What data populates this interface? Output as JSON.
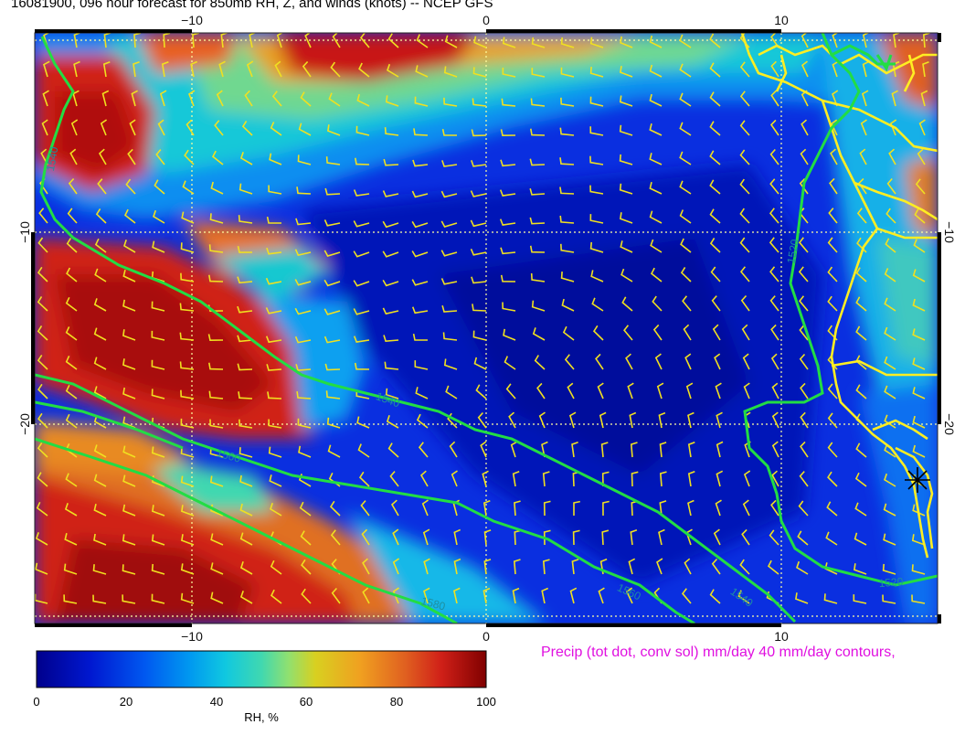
{
  "header": {
    "title": "16081900, 096 hour forecast for 850mb RH, Z, and winds (knots)  -- NCEP GFS"
  },
  "footer": {
    "precip_note": "Precip (tot dot, conv sol) mm/day 40 mm/day contours,"
  },
  "colorbar": {
    "label": "RH, %",
    "ticks": [
      "0",
      "20",
      "40",
      "60",
      "80",
      "100"
    ],
    "colors": [
      "#00008c",
      "#0018d0",
      "#0058f0",
      "#0098f0",
      "#10c8e0",
      "#40d8b0",
      "#90e070",
      "#d8d020",
      "#f0a020",
      "#e06020",
      "#d02018",
      "#800000"
    ]
  },
  "map": {
    "lon_ticks_top": [
      "−10",
      "0",
      "10"
    ],
    "lon_ticks_bottom": [
      "−10",
      "0",
      "10"
    ],
    "lat_ticks_left": [
      "−10",
      "−20"
    ],
    "lat_ticks_right": [
      "−10",
      "−20"
    ],
    "contour_labels": [
      "1540",
      "1540",
      "1560",
      "1560",
      "1580",
      "1540",
      "1520",
      "1520",
      "1560"
    ],
    "accent_colors": {
      "contour": "#22dd44",
      "wind_barb": "#f0e020",
      "coastline": "#ffee22",
      "precip_text": "#e010e0"
    }
  }
}
